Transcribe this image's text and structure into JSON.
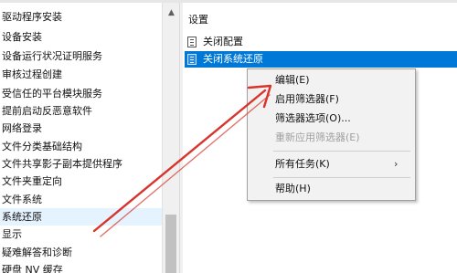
{
  "tree": {
    "items": [
      {
        "label": "驱动程序安装",
        "selected": false
      },
      {
        "label": "设备安装",
        "selected": false
      },
      {
        "label": "设备运行状况证明服务",
        "selected": false
      },
      {
        "label": "审核过程创建",
        "selected": false
      },
      {
        "label": "受信任的平台模块服务",
        "selected": false
      },
      {
        "label": "提前启动反恶意软件",
        "selected": false
      },
      {
        "label": "网络登录",
        "selected": false
      },
      {
        "label": "文件分类基础结构",
        "selected": false
      },
      {
        "label": "文件共享影子副本提供程序",
        "selected": false
      },
      {
        "label": "文件夹重定向",
        "selected": false
      },
      {
        "label": "文件系统",
        "selected": false
      },
      {
        "label": "系统还原",
        "selected": true
      },
      {
        "label": "显示",
        "selected": false
      },
      {
        "label": "疑难解答和诊断",
        "selected": false
      },
      {
        "label": "硬盘 NV 缓存",
        "selected": false
      }
    ],
    "scroll_up_glyph": "▲"
  },
  "list": {
    "header": "设置",
    "rows": [
      {
        "label": "关闭配置",
        "selected": false
      },
      {
        "label": "关闭系统还原",
        "selected": true
      }
    ]
  },
  "context_menu": {
    "items": [
      {
        "label": "编辑(E)",
        "disabled": false
      },
      {
        "label": "启用筛选器(F)",
        "disabled": false
      },
      {
        "label": "筛选器选项(O)...",
        "disabled": false
      },
      {
        "label": "重新应用筛选器(E)",
        "disabled": true
      },
      {
        "label": "所有任务(K)",
        "disabled": false,
        "submenu": true
      },
      {
        "label": "帮助(H)",
        "disabled": false
      }
    ],
    "submenu_glyph": "›"
  },
  "colors": {
    "selection_blue": "#0078d7",
    "tree_selection": "#e5f3ff",
    "arrow_red": "#d9342b",
    "menu_bg": "#f2f2f2"
  }
}
